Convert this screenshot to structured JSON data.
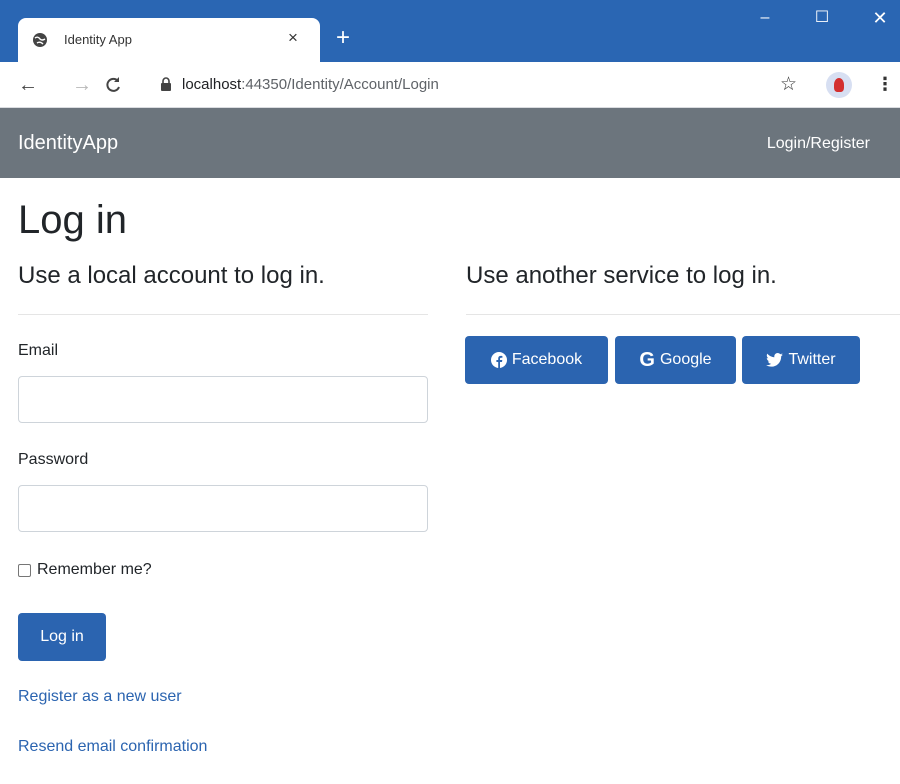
{
  "browser": {
    "tab_title": "Identity App",
    "tab_close": "×",
    "new_tab": "+",
    "url_host": "localhost",
    "url_port": ":44350",
    "url_path": "/Identity/Account/Login",
    "window_controls": {
      "minimize": "–",
      "maximize": "☐",
      "close": "✕"
    }
  },
  "navbar": {
    "brand": "IdentityApp",
    "login_register": "Login/Register"
  },
  "page": {
    "title": "Log in",
    "local_heading": "Use a local account to log in.",
    "external_heading": "Use another service to log in.",
    "email_label": "Email",
    "email_value": "",
    "password_label": "Password",
    "password_value": "",
    "remember_label": "Remember me?",
    "remember_checked": false,
    "login_button": "Log in",
    "register_link": "Register as a new user",
    "resend_link": "Resend email confirmation"
  },
  "services": [
    {
      "label": "Facebook",
      "icon": "facebook-icon"
    },
    {
      "label": "Google",
      "icon": "google-icon"
    },
    {
      "label": "Twitter",
      "icon": "twitter-icon"
    }
  ],
  "colors": {
    "titlebar": "#2a66b3",
    "navbar": "#6c757d",
    "primary": "#2b64b0"
  }
}
